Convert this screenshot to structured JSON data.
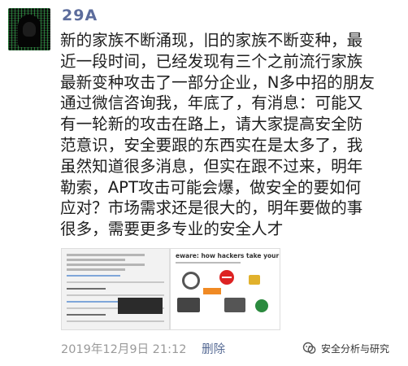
{
  "post": {
    "author": "29A",
    "lines": [
      "新的家族不断涌现，旧的家族不断变种，最",
      "近一段时间，已经发现有三个之前流行家族",
      "最新变种攻击了一部分企业，N多中招的朋友",
      "通过微信咨询我，年底了，有消息：可能又",
      "有一轮新的攻击在路上，请大家提高安全防",
      "范意识，安全要跟的东西实在是太多了，我",
      "虽然知道很多消息，但实在跟不过来，明年",
      "勒索，APT攻击可能会爆，做安全的要如何",
      "应对？市场需求还是很大的，明年要做的事",
      "很多，需要更多专业的安全人才"
    ],
    "thumbnail_2_title": "eware: how hackers take your data hostage",
    "timestamp": "2019年12月9日 21:12",
    "delete_label": "删除"
  },
  "watermark": {
    "text": "安全分析与研究",
    "icon": "wechat-channel-icon"
  }
}
